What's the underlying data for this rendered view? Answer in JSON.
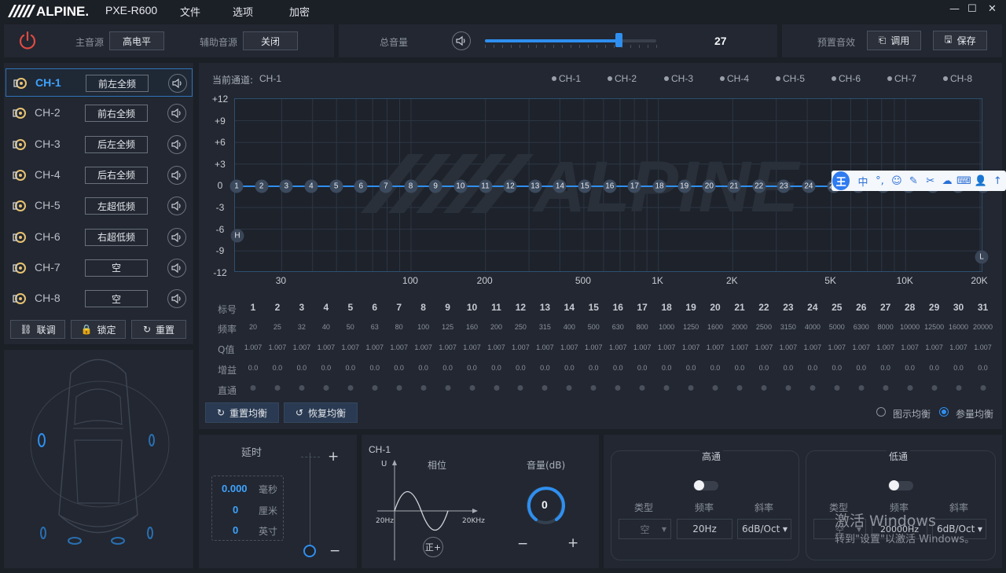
{
  "titlebar": {
    "brand": "ALPINE.",
    "model": "PXE-R600",
    "menu": [
      "文件",
      "选项",
      "加密"
    ],
    "controls": {
      "minimize": "—",
      "maximize": "☐",
      "close": "✕"
    }
  },
  "topbar": {
    "main_source_label": "主音源",
    "main_source_value": "高电平",
    "aux_source_label": "辅助音源",
    "aux_source_value": "关闭",
    "master_volume_label": "总音量",
    "master_volume_value": "27",
    "master_volume_fraction": 0.78,
    "preset_label": "预置音效",
    "recall_button": "调用",
    "save_button": "保存"
  },
  "channels": [
    {
      "name": "CH-1",
      "assign": "前左全频",
      "active": true
    },
    {
      "name": "CH-2",
      "assign": "前右全频",
      "active": false
    },
    {
      "name": "CH-3",
      "assign": "后左全频",
      "active": false
    },
    {
      "name": "CH-4",
      "assign": "后右全频",
      "active": false
    },
    {
      "name": "CH-5",
      "assign": "左超低频",
      "active": false
    },
    {
      "name": "CH-6",
      "assign": "右超低频",
      "active": false
    },
    {
      "name": "CH-7",
      "assign": "空",
      "active": false
    },
    {
      "name": "CH-8",
      "assign": "空",
      "active": false
    }
  ],
  "channel_actions": {
    "link": "联调",
    "lock": "锁定",
    "reset": "重置"
  },
  "eq": {
    "current_channel_label": "当前通道:",
    "current_channel_value": "CH-1",
    "legend": [
      "CH-1",
      "CH-2",
      "CH-3",
      "CH-4",
      "CH-5",
      "CH-6",
      "CH-7",
      "CH-8"
    ],
    "y_ticks": [
      "+12",
      "+9",
      "+6",
      "+3",
      "0",
      "-3",
      "-6",
      "-9",
      "-12"
    ],
    "x_ticks": [
      "30",
      "100",
      "200",
      "500",
      "1K",
      "2K",
      "5K",
      "10K",
      "20K"
    ],
    "watermark": "ALPINE",
    "hp_marker": "H",
    "lp_marker": "L",
    "row_labels": {
      "index": "标号",
      "freq": "频率",
      "q": "Q值",
      "gain": "增益",
      "bypass": "直通"
    },
    "bands": [
      {
        "idx": "1",
        "freq": "20",
        "q": "1.007",
        "gain": "0.0"
      },
      {
        "idx": "2",
        "freq": "25",
        "q": "1.007",
        "gain": "0.0"
      },
      {
        "idx": "3",
        "freq": "32",
        "q": "1.007",
        "gain": "0.0"
      },
      {
        "idx": "4",
        "freq": "40",
        "q": "1.007",
        "gain": "0.0"
      },
      {
        "idx": "5",
        "freq": "50",
        "q": "1.007",
        "gain": "0.0"
      },
      {
        "idx": "6",
        "freq": "63",
        "q": "1.007",
        "gain": "0.0"
      },
      {
        "idx": "7",
        "freq": "80",
        "q": "1.007",
        "gain": "0.0"
      },
      {
        "idx": "8",
        "freq": "100",
        "q": "1.007",
        "gain": "0.0"
      },
      {
        "idx": "9",
        "freq": "125",
        "q": "1.007",
        "gain": "0.0"
      },
      {
        "idx": "10",
        "freq": "160",
        "q": "1.007",
        "gain": "0.0"
      },
      {
        "idx": "11",
        "freq": "200",
        "q": "1.007",
        "gain": "0.0"
      },
      {
        "idx": "12",
        "freq": "250",
        "q": "1.007",
        "gain": "0.0"
      },
      {
        "idx": "13",
        "freq": "315",
        "q": "1.007",
        "gain": "0.0"
      },
      {
        "idx": "14",
        "freq": "400",
        "q": "1.007",
        "gain": "0.0"
      },
      {
        "idx": "15",
        "freq": "500",
        "q": "1.007",
        "gain": "0.0"
      },
      {
        "idx": "16",
        "freq": "630",
        "q": "1.007",
        "gain": "0.0"
      },
      {
        "idx": "17",
        "freq": "800",
        "q": "1.007",
        "gain": "0.0"
      },
      {
        "idx": "18",
        "freq": "1000",
        "q": "1.007",
        "gain": "0.0"
      },
      {
        "idx": "19",
        "freq": "1250",
        "q": "1.007",
        "gain": "0.0"
      },
      {
        "idx": "20",
        "freq": "1600",
        "q": "1.007",
        "gain": "0.0"
      },
      {
        "idx": "21",
        "freq": "2000",
        "q": "1.007",
        "gain": "0.0"
      },
      {
        "idx": "22",
        "freq": "2500",
        "q": "1.007",
        "gain": "0.0"
      },
      {
        "idx": "23",
        "freq": "3150",
        "q": "1.007",
        "gain": "0.0"
      },
      {
        "idx": "24",
        "freq": "4000",
        "q": "1.007",
        "gain": "0.0"
      },
      {
        "idx": "25",
        "freq": "5000",
        "q": "1.007",
        "gain": "0.0"
      },
      {
        "idx": "26",
        "freq": "6300",
        "q": "1.007",
        "gain": "0.0"
      },
      {
        "idx": "27",
        "freq": "8000",
        "q": "1.007",
        "gain": "0.0"
      },
      {
        "idx": "28",
        "freq": "10000",
        "q": "1.007",
        "gain": "0.0"
      },
      {
        "idx": "29",
        "freq": "12500",
        "q": "1.007",
        "gain": "0.0"
      },
      {
        "idx": "30",
        "freq": "16000",
        "q": "1.007",
        "gain": "0.0"
      },
      {
        "idx": "31",
        "freq": "20000",
        "q": "1.007",
        "gain": "0.0"
      }
    ],
    "reset_eq": "重置均衡",
    "restore_eq": "恢复均衡",
    "mode_graphic": "图示均衡",
    "mode_parametric": "参量均衡",
    "mode_selected": "参量均衡"
  },
  "delay": {
    "title": "延时",
    "ms_value": "0.000",
    "ms_unit": "毫秒",
    "cm_value": "0",
    "cm_unit": "厘米",
    "inch_value": "0",
    "inch_unit": "英寸",
    "plus": "+",
    "minus": "−"
  },
  "phase": {
    "channel": "CH-1",
    "title": "相位",
    "axis_u": "U",
    "freq_low": "20Hz",
    "freq_high": "20KHz",
    "toggle": "正+"
  },
  "level": {
    "title": "音量(dB)",
    "value": "0",
    "minus": "−",
    "plus": "+"
  },
  "highpass": {
    "title": "高通",
    "type_label": "类型",
    "type_value": "空",
    "freq_label": "频率",
    "freq_value": "20Hz",
    "slope_label": "斜率",
    "slope_value": "6dB/Oct"
  },
  "lowpass": {
    "title": "低通",
    "type_label": "类型",
    "type_value": "空",
    "freq_label": "频率",
    "freq_value": "20000Hz",
    "slope_label": "斜率",
    "slope_value": "6dB/Oct"
  },
  "ime_toolbar": {
    "logo": "王",
    "mode": "中",
    "items": [
      "°,",
      "☺",
      "✎",
      "✂",
      "☁",
      "⌨",
      "👤",
      "↑"
    ]
  },
  "windows_watermark": {
    "line1": "激活 Windows",
    "line2": "转到\"设置\"以激活 Windows。"
  },
  "colors": {
    "accent": "#2f8ff0",
    "active_text": "#3ea3ff",
    "panel": "#222731",
    "background": "#1b1f26"
  }
}
